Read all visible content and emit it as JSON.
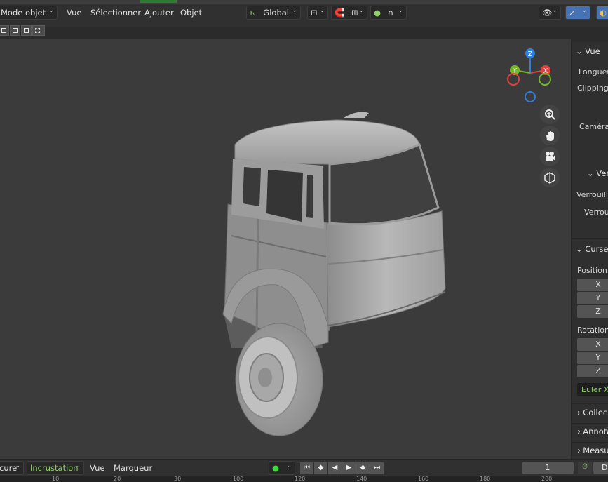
{
  "header": {
    "mode_label": "Mode objet",
    "menus": [
      "Vue",
      "Sélectionner",
      "Ajouter",
      "Objet"
    ],
    "transform_orientation": "Global"
  },
  "viewport": {
    "gizmo": {
      "z": "Z",
      "y": "Y",
      "x": "X"
    },
    "nav_icons": [
      "zoom-icon",
      "hand-pan-icon",
      "camera-icon",
      "grid-ortho-icon"
    ]
  },
  "sidebar": {
    "vue_header": "Vue",
    "longueur": "Longueur",
    "clipping": "Clipping:",
    "camera": "Caméra",
    "verr_header": "Ver",
    "verrouiller": "Verrouille",
    "verrouiller2": "Verroui",
    "cursor_header": "Curseu",
    "position_label": "Position:",
    "rotation_label": "Rotation:",
    "axes": [
      "X",
      "Y",
      "Z"
    ],
    "rot_mode": "Euler X",
    "collections": "Collec",
    "annotations": "Annota",
    "measure": "Measu"
  },
  "timeline": {
    "mode_label": "cure",
    "keying_label": "Incrustation",
    "vue": "Vue",
    "marqueur": "Marqueur",
    "current_frame": "1",
    "start_label": "D"
  },
  "ruler": {
    "ticks": [
      "10",
      "20",
      "30",
      "100",
      "120",
      "140",
      "160",
      "180",
      "200"
    ]
  },
  "colors": {
    "accent": "#4772b3",
    "active_green": "#8fd16a",
    "x_axis": "#e2413e",
    "y_axis": "#76b72a",
    "z_axis": "#2e7fdc"
  }
}
